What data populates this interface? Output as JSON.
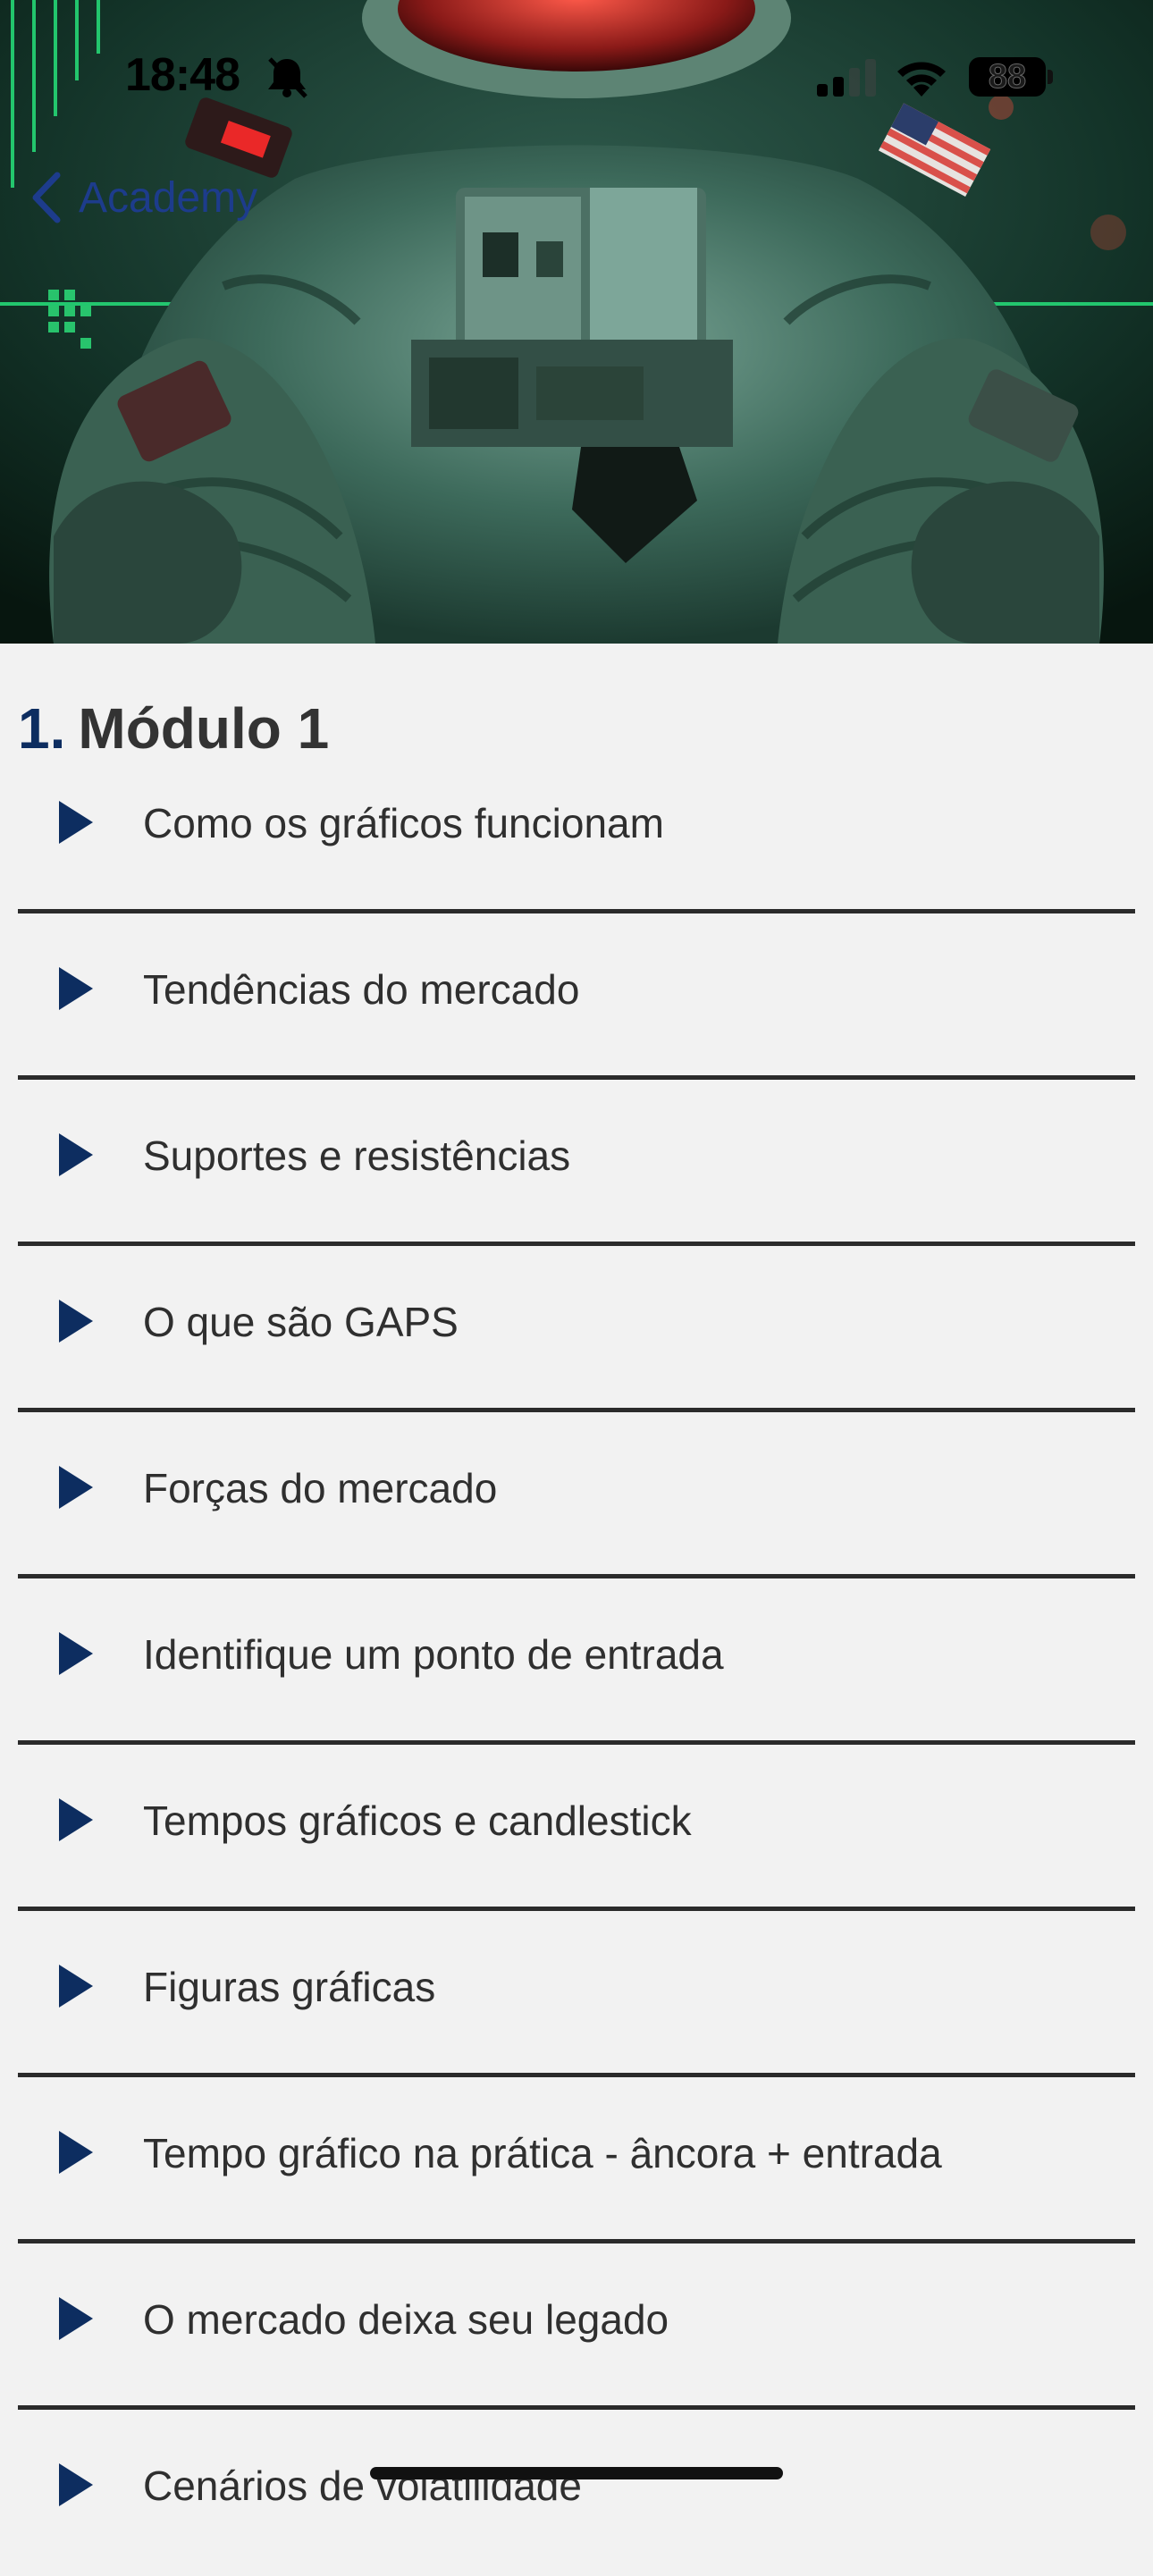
{
  "status": {
    "time": "18:48",
    "battery": "88"
  },
  "nav": {
    "back_label": "Academy"
  },
  "module": {
    "number": "1.",
    "title": "Módulo 1"
  },
  "lessons": [
    {
      "label": "Como os gráficos funcionam"
    },
    {
      "label": "Tendências do mercado"
    },
    {
      "label": "Suportes e resistências"
    },
    {
      "label": "O que são GAPS"
    },
    {
      "label": "Forças do mercado"
    },
    {
      "label": "Identifique um ponto de entrada"
    },
    {
      "label": "Tempos gráficos e candlestick"
    },
    {
      "label": "Figuras gráficas"
    },
    {
      "label": "Tempo gráfico na prática -  âncora + entrada"
    },
    {
      "label": "O mercado deixa seu legado"
    },
    {
      "label": "Cenários de volatilidade"
    }
  ],
  "icons": {
    "back": "chevron-left-icon",
    "play": "play-triangle-icon",
    "bell": "bell-slash-icon",
    "signal": "cellular-signal-icon",
    "wifi": "wifi-icon"
  },
  "colors": {
    "accent": "#0d2d60",
    "back_link": "#1d3c8c",
    "background": "#f2f2f2",
    "divider": "#2b2b2b"
  }
}
